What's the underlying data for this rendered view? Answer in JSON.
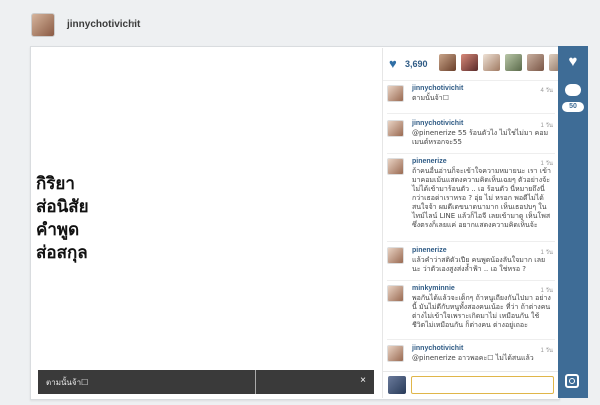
{
  "header": {
    "username": "jinnychotivichit",
    "caret": "▾"
  },
  "photo": {
    "lines": [
      "กิริยา",
      "ส่อนิสัย",
      "คำพูด",
      "ส่อสกุล"
    ]
  },
  "caption_bar": {
    "text": "ตามนั้นจ้า☐",
    "close": "×"
  },
  "likes": {
    "count": "3,690",
    "heart_icon": "heart-icon"
  },
  "comments": [
    {
      "user": "jinnychotivichit",
      "time": "4 วัน",
      "text": "ตามนั้นจ้า☐"
    },
    {
      "user": "jinnychotivichit",
      "time": "1 วัน",
      "text": "@pinenerize 55 ร้อนตัวไง ไม่ใช่ไม่มา คอมเมนต์หรอกจะ55"
    },
    {
      "user": "pinenerize",
      "time": "1 วัน",
      "text": "ถ้าคนอื่นอ่านก็จะเข้าใจความหมายนะ เรา เข้ามาคอมเม้นแสดงความคิดเห็นเฉยๆ ตัวอย่างจ้ะ ไม่ได้เข้ามาร้อนตัว .. เอ ร้อนตัว นี่หมายถึงนี่กว่าเธอด่าเราหรอ ? อุ่ย ไม่ หรอก พอดีไม่ได้สนใจจ้า ผมดีเดขนาดนามาก เห็นเธอปบๆ ในไทม์ไลน์ LINE แล้วก็ไอจี เลยเข้ามาดู เห็นโพสซึ่งตรงก็เลยแค่ อยากแสดงความคิดเห็นจ้ะ"
    },
    {
      "user": "pinenerize",
      "time": "1 วัน",
      "text": "แล้วคำว่าสติตัวเปีย คนพูดน้องลันใจมาก เลยนะ ว่าตัวเองสูงส่งล้ำฟ้า .. เอ ใช่หรอ ?"
    },
    {
      "user": "minkyminnie",
      "time": "1 วัน",
      "text": "พอกันได้แล้วจะเด็กๆ ถ้าหนูเถียงกันไปมา อย่างนี้ มันไม่ดีกับหนูทั้งสองคนเน้อะ ที่ว่า ถ้าต่างคนต่างไม่เข้าใจเพราะเกิดมาไม่ เหมือนกัน ใช้ชีวิตไม่เหมือนกัน ก็ต่างคน ต่างอยู่เถอะ"
    },
    {
      "user": "jinnychotivichit",
      "time": "1 วัน",
      "text": "@pinenerize อาวพอคะ☐ ไม่ได้สนแล้ว"
    }
  ],
  "input": {
    "placeholder": ""
  },
  "rail": {
    "comment_count": "50"
  }
}
